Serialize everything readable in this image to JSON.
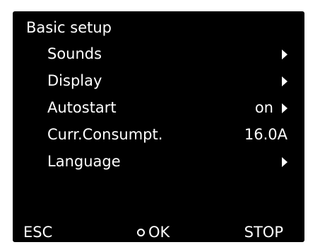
{
  "screen": {
    "title": "Basic setup"
  },
  "menu": {
    "items": [
      {
        "label": "Sounds",
        "value": ""
      },
      {
        "label": "Display",
        "value": ""
      },
      {
        "label": "Autostart",
        "value": "on"
      },
      {
        "label": "Curr.Consumpt.",
        "value": "16.0A"
      },
      {
        "label": "Language",
        "value": ""
      }
    ]
  },
  "footer": {
    "esc_label": "ESC",
    "ok_label": "OK",
    "stop_label": "STOP"
  },
  "colors": {
    "screen_background": "#000000",
    "text": "#ffffff",
    "page_background": "#ffffff"
  },
  "icons": {
    "submenu": "arrow-right-icon",
    "ok": "circle-icon"
  }
}
